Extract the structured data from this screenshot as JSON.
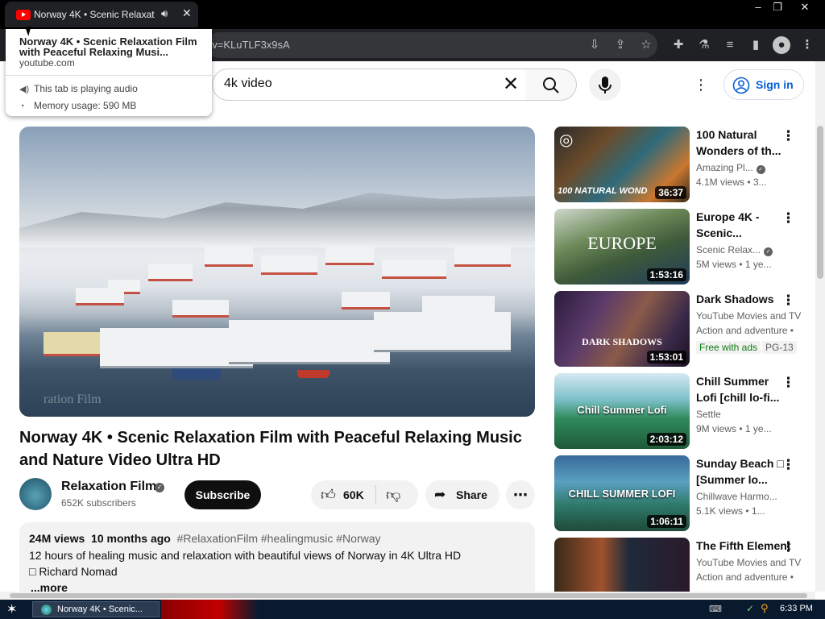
{
  "browser": {
    "tab_title": "Norway 4K • Scenic Relaxation",
    "url_fragment": "?v=KLuTLF3x9sA",
    "hovercard": {
      "title": "Norway 4K • Scenic Relaxation Film with Peaceful Relaxing Musi...",
      "domain": "youtube.com",
      "audio": "This tab is playing audio",
      "memory": "Memory usage: 590 MB"
    }
  },
  "header": {
    "search_value": "4k video",
    "sign_in": "Sign in"
  },
  "video": {
    "title": "Norway 4K • Scenic Relaxation Film with Peaceful Relaxing Music and Nature Video Ultra HD",
    "watermark": "ration Film",
    "channel": "Relaxation Film",
    "subscribers": "652K subscribers",
    "subscribe": "Subscribe",
    "likes": "60K",
    "share": "Share",
    "views": "24M views",
    "age": "10 months ago",
    "tags": "#RelaxationFilm #healingmusic #Norway",
    "desc_line1": "12 hours of healing music and relaxation with beautiful views of Norway in 4K Ultra HD",
    "desc_line2": "□ Richard Nomad",
    "more": "...more"
  },
  "recommendations": [
    {
      "title": "100 Natural Wonders of th...",
      "channel": "Amazing Pl...",
      "meta": "4.1M views  • 3...",
      "duration": "36:37",
      "thumb_text": "100 NATURAL WOND"
    },
    {
      "title": "Europe 4K - Scenic...",
      "channel": "Scenic Relax...",
      "meta": "5M views  • 1 ye...",
      "duration": "1:53:16",
      "thumb_text": "EUROPE"
    },
    {
      "title": "Dark Shadows",
      "channel": "YouTube Movies and TV",
      "meta": "Action and adventure •",
      "duration": "1:53:01",
      "badge_free": "Free with ads",
      "badge_rating": "PG-13",
      "thumb_text": "DARK SHADOWS"
    },
    {
      "title": "Chill Summer Lofi [chill lo-fi...",
      "channel": "Settle",
      "meta": "9M views  • 1 ye...",
      "duration": "2:03:12",
      "thumb_text": "Chill Summer Lofi"
    },
    {
      "title": "Sunday Beach □ [Summer lo...",
      "channel": "Chillwave Harmo...",
      "meta": "5.1K views  • 1...",
      "duration": "1:06:11",
      "thumb_text": "CHILL SUMMER LOFI"
    },
    {
      "title": "The Fifth Element",
      "channel": "YouTube Movies and TV",
      "meta": "Action and adventure •",
      "duration": ""
    }
  ],
  "taskbar": {
    "item": "Norway 4K • Scenic...",
    "clock": "6:33 PM"
  }
}
